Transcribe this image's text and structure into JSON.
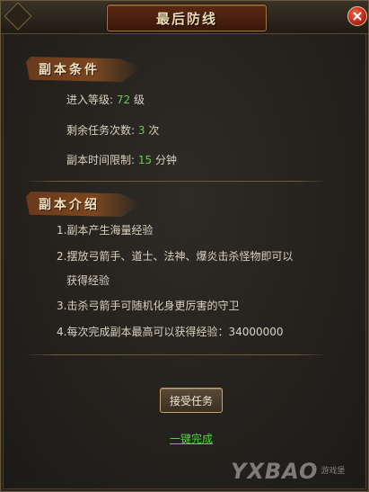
{
  "window": {
    "title": "最后防线"
  },
  "conditions": {
    "header": "副本条件",
    "level_label": "进入等级:",
    "level_value": "72",
    "level_unit": "级",
    "remaining_label": "剩余任务次数:",
    "remaining_value": "3",
    "remaining_unit": "次",
    "time_label": "副本时间限制:",
    "time_value": "15",
    "time_unit": "分钟"
  },
  "intro": {
    "header": "副本介绍",
    "lines": [
      "1.副本产生海量经验",
      "2.摆放弓箭手、道士、法神、爆炎击杀怪物即可以",
      "获得经验",
      "3.击杀弓箭手可随机化身更厉害的守卫",
      "4.每次完成副本最高可以获得经验：34000000"
    ]
  },
  "actions": {
    "accept": "接受任务",
    "one_key": "一键完成"
  },
  "watermark": {
    "brand": "YXBAO",
    "site_small": "游戏堡"
  }
}
